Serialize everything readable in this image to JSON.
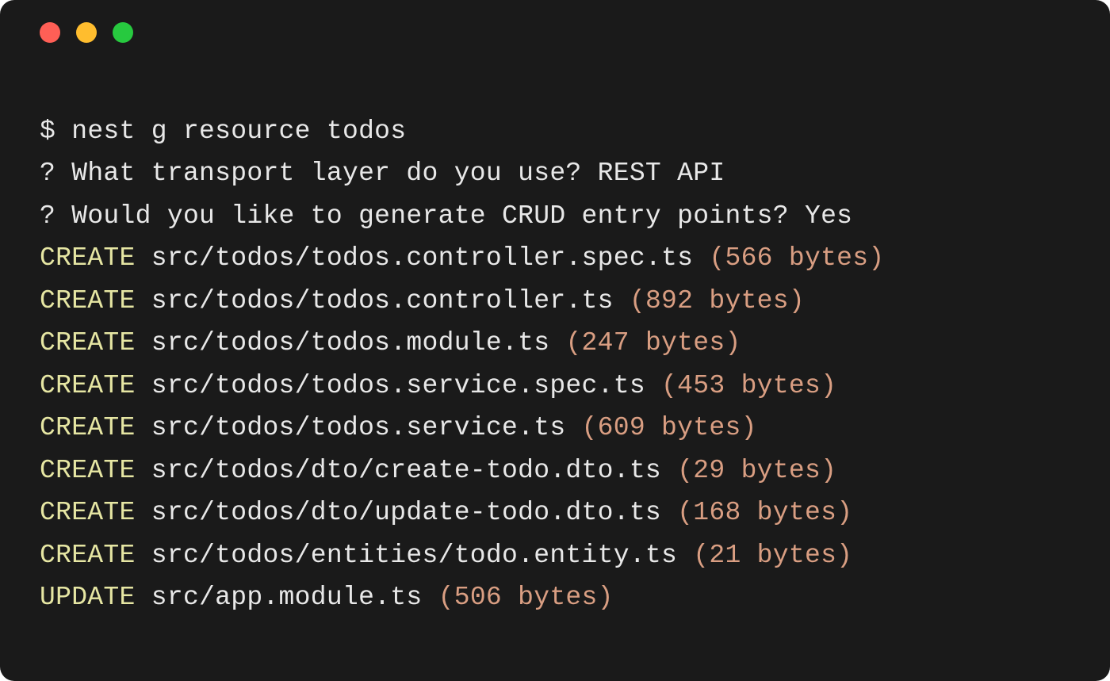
{
  "command": {
    "prompt": "$ ",
    "text": "nest g resource todos"
  },
  "questions": [
    {
      "marker": "? ",
      "question": "What transport layer do you use? ",
      "answer": "REST API"
    },
    {
      "marker": "? ",
      "question": "Would you like to generate CRUD entry points? ",
      "answer": "Yes"
    }
  ],
  "output": [
    {
      "action": "CREATE",
      "path": "src/todos/todos.controller.spec.ts",
      "size": "(566 bytes)"
    },
    {
      "action": "CREATE",
      "path": "src/todos/todos.controller.ts",
      "size": "(892 bytes)"
    },
    {
      "action": "CREATE",
      "path": "src/todos/todos.module.ts",
      "size": "(247 bytes)"
    },
    {
      "action": "CREATE",
      "path": "src/todos/todos.service.spec.ts",
      "size": "(453 bytes)"
    },
    {
      "action": "CREATE",
      "path": "src/todos/todos.service.ts",
      "size": "(609 bytes)"
    },
    {
      "action": "CREATE",
      "path": "src/todos/dto/create-todo.dto.ts",
      "size": "(29 bytes)"
    },
    {
      "action": "CREATE",
      "path": "src/todos/dto/update-todo.dto.ts",
      "size": "(168 bytes)"
    },
    {
      "action": "CREATE",
      "path": "src/todos/entities/todo.entity.ts",
      "size": "(21 bytes)"
    },
    {
      "action": "UPDATE",
      "path": "src/app.module.ts",
      "size": "(506 bytes)"
    }
  ]
}
